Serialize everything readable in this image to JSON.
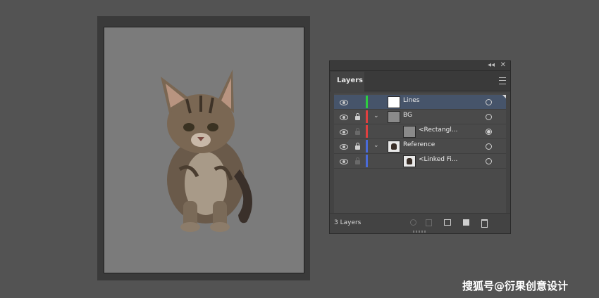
{
  "panel": {
    "collapse_glyph": "◂◂",
    "close_glyph": "✕",
    "tab_label": "Layers",
    "menu_icon": "hamburger-menu-icon",
    "layer_count": "3 Layers"
  },
  "layers": [
    {
      "name": "Lines",
      "color": "#2ecc40",
      "selected": true
    },
    {
      "name": "BG",
      "color": "#e04040",
      "expanded": true
    },
    {
      "name": "<Rectangl...",
      "color": "#e04040"
    },
    {
      "name": "Reference",
      "color": "#4a6bd8",
      "expanded": true
    },
    {
      "name": "<Linked Fi...",
      "color": "#4a6bd8"
    }
  ],
  "chevron_glyph": "⌄",
  "watermark": "搜狐号@衍果创意设计"
}
